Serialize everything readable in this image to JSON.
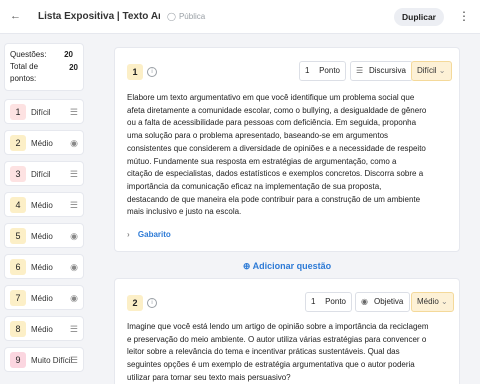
{
  "header": {
    "back_icon": "arrow-left-icon",
    "title": "Lista Expositiva | Texto Arg...",
    "visibility_label": "Pública",
    "duplicate_label": "Duplicar"
  },
  "stats": {
    "questions_label": "Questões:",
    "questions_value": "20",
    "points_label": "Total de pontos:",
    "points_value": "20"
  },
  "sidebar": {
    "items": [
      {
        "num": "1",
        "difficulty": "Difícil",
        "type_icon": "lines-icon",
        "num_bg": "#fde2e2"
      },
      {
        "num": "2",
        "difficulty": "Médio",
        "type_icon": "radio-icon",
        "num_bg": "#fcefc7"
      },
      {
        "num": "3",
        "difficulty": "Difícil",
        "type_icon": "lines-icon",
        "num_bg": "#fde2e2"
      },
      {
        "num": "4",
        "difficulty": "Médio",
        "type_icon": "lines-icon",
        "num_bg": "#fcefc7"
      },
      {
        "num": "5",
        "difficulty": "Médio",
        "type_icon": "radio-icon",
        "num_bg": "#fcefc7"
      },
      {
        "num": "6",
        "difficulty": "Médio",
        "type_icon": "radio-icon",
        "num_bg": "#fcefc7"
      },
      {
        "num": "7",
        "difficulty": "Médio",
        "type_icon": "radio-icon",
        "num_bg": "#fcefc7"
      },
      {
        "num": "8",
        "difficulty": "Médio",
        "type_icon": "lines-icon",
        "num_bg": "#fcefc7"
      },
      {
        "num": "9",
        "difficulty": "Muito Difícil",
        "type_icon": "lines-icon",
        "num_bg": "#fbd6e0"
      }
    ]
  },
  "questions": [
    {
      "num": "1",
      "points_value": "1",
      "points_label": "Ponto",
      "type_label": "Discursiva",
      "difficulty_label": "Difícil",
      "lines": [
        "Elabore um texto argumentativo em que você identifique um problema social que",
        "afeta diretamente a comunidade escolar, como o bullying, a desigualdade de gênero",
        "ou a falta de acessibilidade para pessoas com deficiência. Em seguida, proponha",
        "uma solução para o problema apresentado, baseando-se em argumentos",
        "consistentes que considerem a diversidade de opiniões e a necessidade de respeito",
        "mútuo. Fundamente sua resposta em estratégias de argumentação, como a",
        "citação de especialistas, dados estatísticos e exemplos concretos. Discorra sobre a",
        "importância da comunicação eficaz na implementação de sua proposta,",
        "destacando de que maneira ela pode contribuir para a construção de um ambiente",
        "mais inclusivo e justo na escola."
      ],
      "answer_label": "Gabarito"
    },
    {
      "num": "2",
      "points_value": "1",
      "points_label": "Ponto",
      "type_label": "Objetiva",
      "difficulty_label": "Médio",
      "lines": [
        "Imagine que você está lendo um artigo de opinião sobre a importância da reciclagem",
        "e preservação do meio ambiente. O autor utiliza várias estratégias para convencer o",
        "leitor sobre a relevância do tema e incentivar práticas sustentáveis. Qual das",
        "seguintes opções é um exemplo de estratégia argumentativa que o autor poderia",
        "utilizar para tornar seu texto mais persuasivo?"
      ]
    }
  ],
  "add_question_label": "Adicionar questão",
  "colors": {
    "accent": "#2e7bd6",
    "difficulty_bg": "#fdf1d6"
  }
}
